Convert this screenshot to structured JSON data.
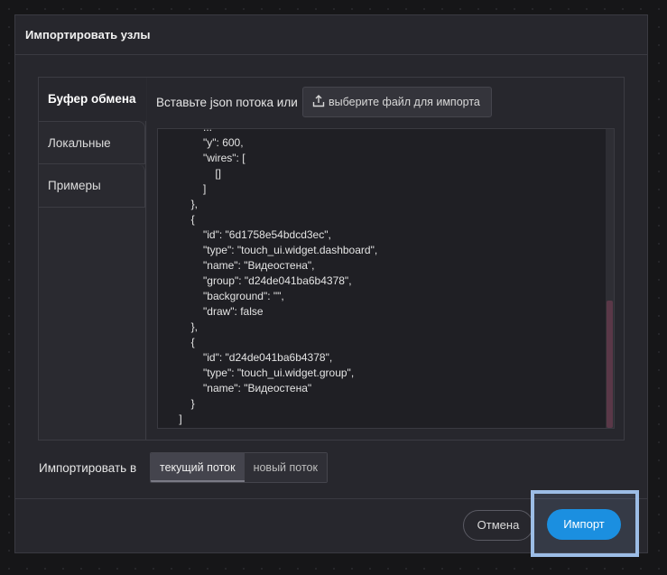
{
  "dialog": {
    "title": "Импортировать узлы"
  },
  "tabs": [
    {
      "label": "Буфер обмена"
    },
    {
      "label": "Локальные"
    },
    {
      "label": "Примеры"
    }
  ],
  "clipboard": {
    "paste_label": "Вставьте json потока или",
    "file_button_label": "выберите файл для импорта",
    "json_text": "            ...\n            \"y\": 600,\n            \"wires\": [\n                []\n            ]\n        },\n        {\n            \"id\": \"6d1758e54bdcd3ec\",\n            \"type\": \"touch_ui.widget.dashboard\",\n            \"name\": \"Видеостена\",\n            \"group\": \"d24de041ba6b4378\",\n            \"background\": \"\",\n            \"draw\": false\n        },\n        {\n            \"id\": \"d24de041ba6b4378\",\n            \"type\": \"touch_ui.widget.group\",\n            \"name\": \"Видеостена\"\n        }\n    ]"
  },
  "import_to": {
    "label": "Импортировать в",
    "options": [
      {
        "label": "текущий поток",
        "selected": true
      },
      {
        "label": "новый поток",
        "selected": false
      }
    ]
  },
  "footer": {
    "cancel_label": "Отмена",
    "import_label": "Импорт"
  },
  "colors": {
    "accent": "#1b8fe0",
    "highlight": "#9cbde6",
    "dialog_bg": "#27272d"
  },
  "icons": {
    "file_button": "upload-icon"
  }
}
